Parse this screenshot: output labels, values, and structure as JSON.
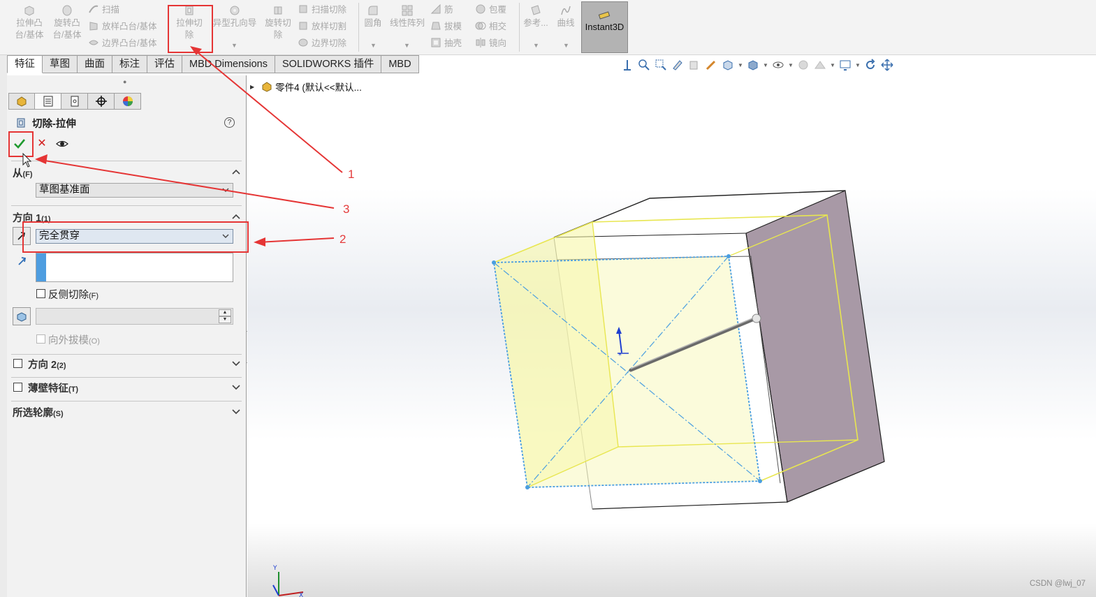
{
  "ribbon": {
    "extrude_boss": "拉伸凸\n台/基体",
    "revolve_boss": "旋转凸\n台/基体",
    "sweep": "扫描",
    "loft_boss": "放样凸台/基体",
    "boundary_boss": "边界凸台/基体",
    "extrude_cut": "拉伸切\n除",
    "hole_wizard": "异型孔向导",
    "revolve_cut": "旋转切\n除",
    "swept_cut": "扫描切除",
    "lofted_cut": "放样切割",
    "boundary_cut": "边界切除",
    "fillet": "圆角",
    "linear_pattern": "线性阵列",
    "rib": "筋",
    "draft": "拔模",
    "shell": "抽壳",
    "wrap": "包覆",
    "intersect": "相交",
    "mirror": "镜向",
    "reference": "参考...",
    "curves": "曲线",
    "instant3d": "Instant3D"
  },
  "tabs": [
    "特征",
    "草图",
    "曲面",
    "标注",
    "评估",
    "MBD Dimensions",
    "SOLIDWORKS 插件",
    "MBD"
  ],
  "tree": {
    "part_label": "零件4 (默认<<默认..."
  },
  "property_manager": {
    "title": "切除-拉伸",
    "help": "?",
    "from": {
      "label": "从",
      "key": "(F)",
      "value": "草图基准面"
    },
    "direction1": {
      "label": "方向 1",
      "key": "(1)",
      "end_condition": "完全贯穿",
      "flip_side_cut": "反侧切除",
      "flip_side_cut_key": "(F)",
      "draft_outward": "向外拔模",
      "draft_outward_key": "(O)"
    },
    "direction2": {
      "label": "方向 2",
      "key": "(2)"
    },
    "thin_feature": {
      "label": "薄壁特征",
      "key": "(T)"
    },
    "selected_contours": {
      "label": "所选轮廓",
      "key": "(S)"
    }
  },
  "callouts": [
    "1",
    "2",
    "3"
  ],
  "watermark": "CSDN @lwj_07",
  "colors": {
    "annotation_red": "#e53535",
    "ribbon_bg": "#f3f3f3",
    "preview_yellow": "#f2f27a",
    "sketch_blue": "#4a9ee0",
    "end_face": "#a899a6"
  }
}
